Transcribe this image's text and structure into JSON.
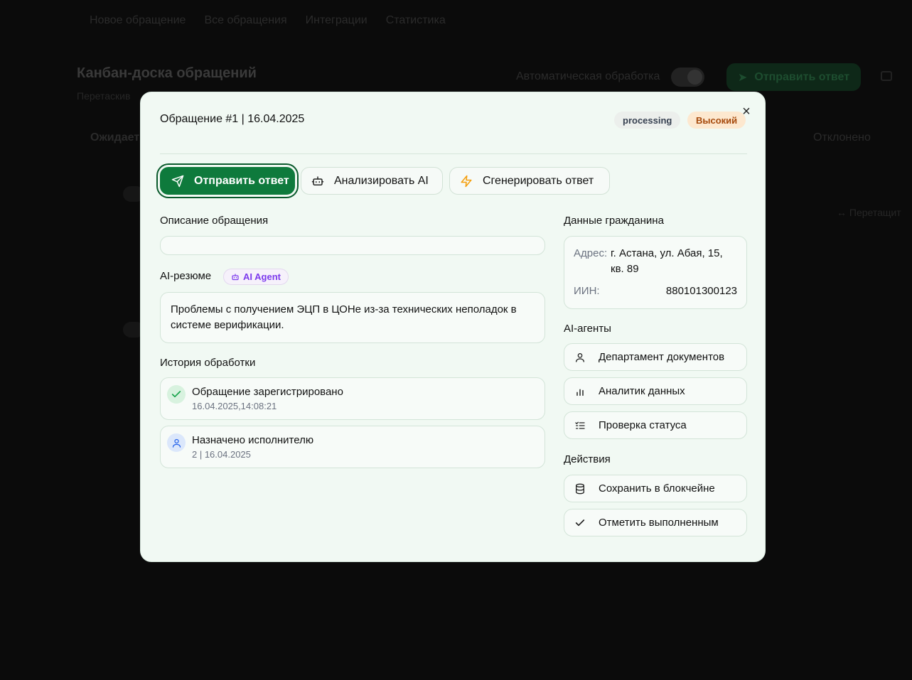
{
  "background": {
    "nav": [
      "Новое обращение",
      "Все обращения",
      "Интеграции",
      "Статистика"
    ],
    "title": "Канбан-доска обращений",
    "subtitle": "Перетаскив",
    "auto_label": "Автоматическая обработка",
    "send_label": "Отправить ответ",
    "column_left": "Ожидает",
    "column_right": "Отклонено",
    "drag_hint": "Перетащит"
  },
  "modal": {
    "title": "Обращение #1 | 16.04.2025",
    "status": "processing",
    "priority": "Высокий",
    "actions": {
      "send": "Отправить ответ",
      "analyze": "Анализировать AI",
      "generate": "Сгенерировать ответ"
    },
    "description_label": "Описание обращения",
    "description_value": "",
    "summary_label": "AI-резюме",
    "summary_chip": "AI Agent",
    "summary_text": "Проблемы с получением ЭЦП в ЦОНе из-за технических неполадок в системе верификации.",
    "history_label": "История обработки",
    "history": [
      {
        "title": "Обращение зарегистрировано",
        "subtitle": "16.04.2025,14:08:21",
        "icon": "check-icon"
      },
      {
        "title": "Назначено исполнителю",
        "subtitle": "2 | 16.04.2025",
        "icon": "user-icon"
      }
    ],
    "citizen_label": "Данные гражданина",
    "citizen": {
      "address_key": "Адрес:",
      "address_line1": "г. Астана, ул. Абая, 15,",
      "address_line2": "кв. 89",
      "iin_key": "ИИН:",
      "iin_value": "880101300123"
    },
    "agents_label": "AI-агенты",
    "agents": [
      "Департамент документов",
      "Аналитик данных",
      "Проверка статуса"
    ],
    "actions_label": "Действия",
    "side_actions": [
      "Сохранить в блокчейне",
      "Отметить выполненным"
    ]
  },
  "colors": {
    "accent": "#0e7a3c",
    "modal_bg": "#f1f9f3",
    "priority_bg": "#fde8cf",
    "ai_purple": "#7c3aed",
    "warning_amber": "#f59e0b"
  }
}
